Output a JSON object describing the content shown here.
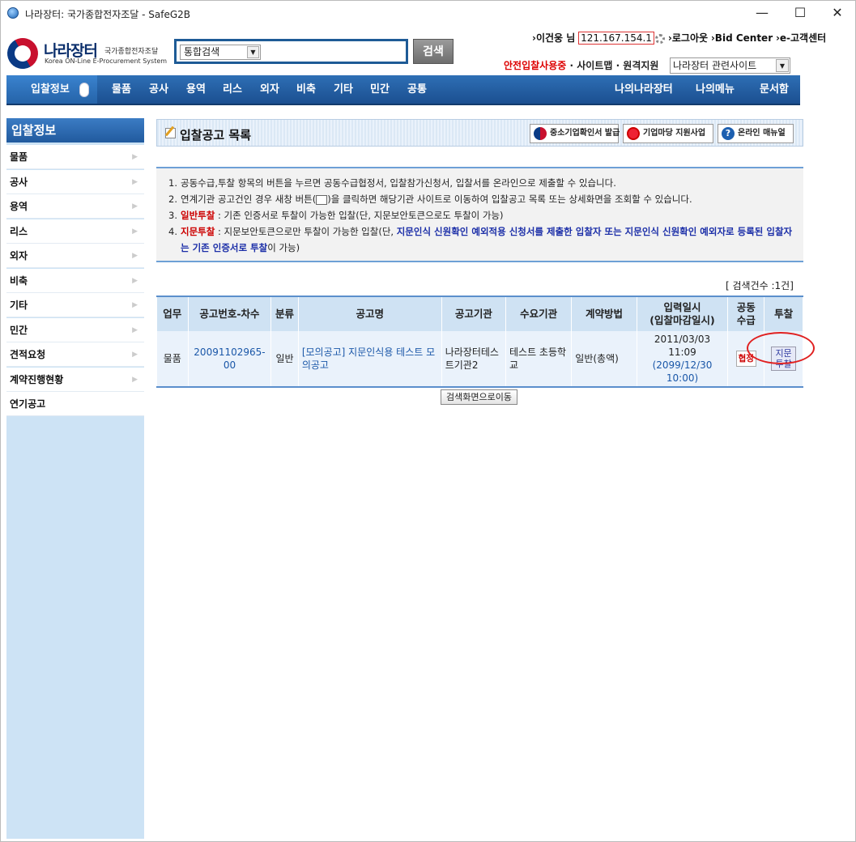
{
  "window": {
    "title": "나라장터: 국가종합전자조달 - SafeG2B",
    "min": "—",
    "max": "☐",
    "close": "✕"
  },
  "logo": {
    "name": "나라장터",
    "sub1": "국가종합전자조달",
    "sub2": "Korea ON-Line E-Procurement System"
  },
  "search": {
    "select_value": "통합검색",
    "button": "검색"
  },
  "user": {
    "prefix": "›이건웅 님",
    "ip": "121.167.154.1",
    "logout": "›로그아웃",
    "bid_center": "›Bid Center",
    "customer": "›e-고객센터"
  },
  "safe": {
    "label": "안전입찰사용중",
    "sitemap": "· 사이트맵",
    "remote": "· 원격지원",
    "related": "나라장터 관련사이트"
  },
  "nav": {
    "home": "입찰정보",
    "items": [
      "물품",
      "공사",
      "용역",
      "리스",
      "외자",
      "비축",
      "기타",
      "민간",
      "공통"
    ],
    "right": [
      "나의나라장터",
      "나의메뉴",
      "문서함"
    ]
  },
  "sidebar": {
    "title": "입찰정보",
    "items": [
      "물품",
      "공사",
      "용역",
      "리스",
      "외자",
      "비축",
      "기타",
      "민간",
      "견적요청",
      "계약진행현황",
      "연기공고"
    ]
  },
  "content": {
    "title": "입찰공고 목록",
    "btn1": "중소기업확인서 발급",
    "btn2": "기업마당 지원사업",
    "btn3": "온라인 매뉴얼"
  },
  "notice": {
    "n1": "1.",
    "l1": "공동수급,투찰 항목의 버튼을 누르면 공동수급협정서, 입찰참가신청서, 입찰서를 온라인으로 제출할 수 있습니다.",
    "n2": "2.",
    "l2a": "연계기관 공고건인 경우 새창 버튼(",
    "l2b": ")을 클릭하면 해당기관 사이트로 이동하여 입찰공고 목록 또는 상세화면을 조회할 수 있습니다.",
    "n3": "3.",
    "l3red": "일반투찰",
    "l3": " : 기존 인증서로 투찰이 가능한 입찰(단, 지문보안토큰으로도 투찰이 가능)",
    "n4": "4.",
    "l4red": "지문투찰",
    "l4a": " : 지문보안토큰으로만 투찰이 가능한 입찰(단, ",
    "l4blue": "지문인식 신원확인 예외적용 신청서를 제출한 입찰자 또는 지문인식 신원확인 예외자로 등록된 입찰자는 기존 인증서로 투찰",
    "l4b": "이 가능)"
  },
  "count": "[ 검색건수 :1건]",
  "table": {
    "headers": [
      "업무",
      "공고번호-차수",
      "분류",
      "공고명",
      "공고기관",
      "수요기관",
      "계약방법",
      "입력일시\n(입찰마감일시)",
      "공동\n수급",
      "투찰"
    ],
    "row": {
      "work": "물품",
      "number": "20091102965-00",
      "type": "일반",
      "name": "[모의공고] 지문인식용 테스트 모의공고",
      "org": "나라장터테스트기관2",
      "demand": "테스트 초등학교",
      "method": "일반(총액)",
      "date1": "2011/03/03 11:09",
      "date2": "(2099/12/30 10:00)",
      "joint": "협정",
      "bid": "지문\n투찰"
    }
  },
  "back_button": "검색화면으로이동"
}
